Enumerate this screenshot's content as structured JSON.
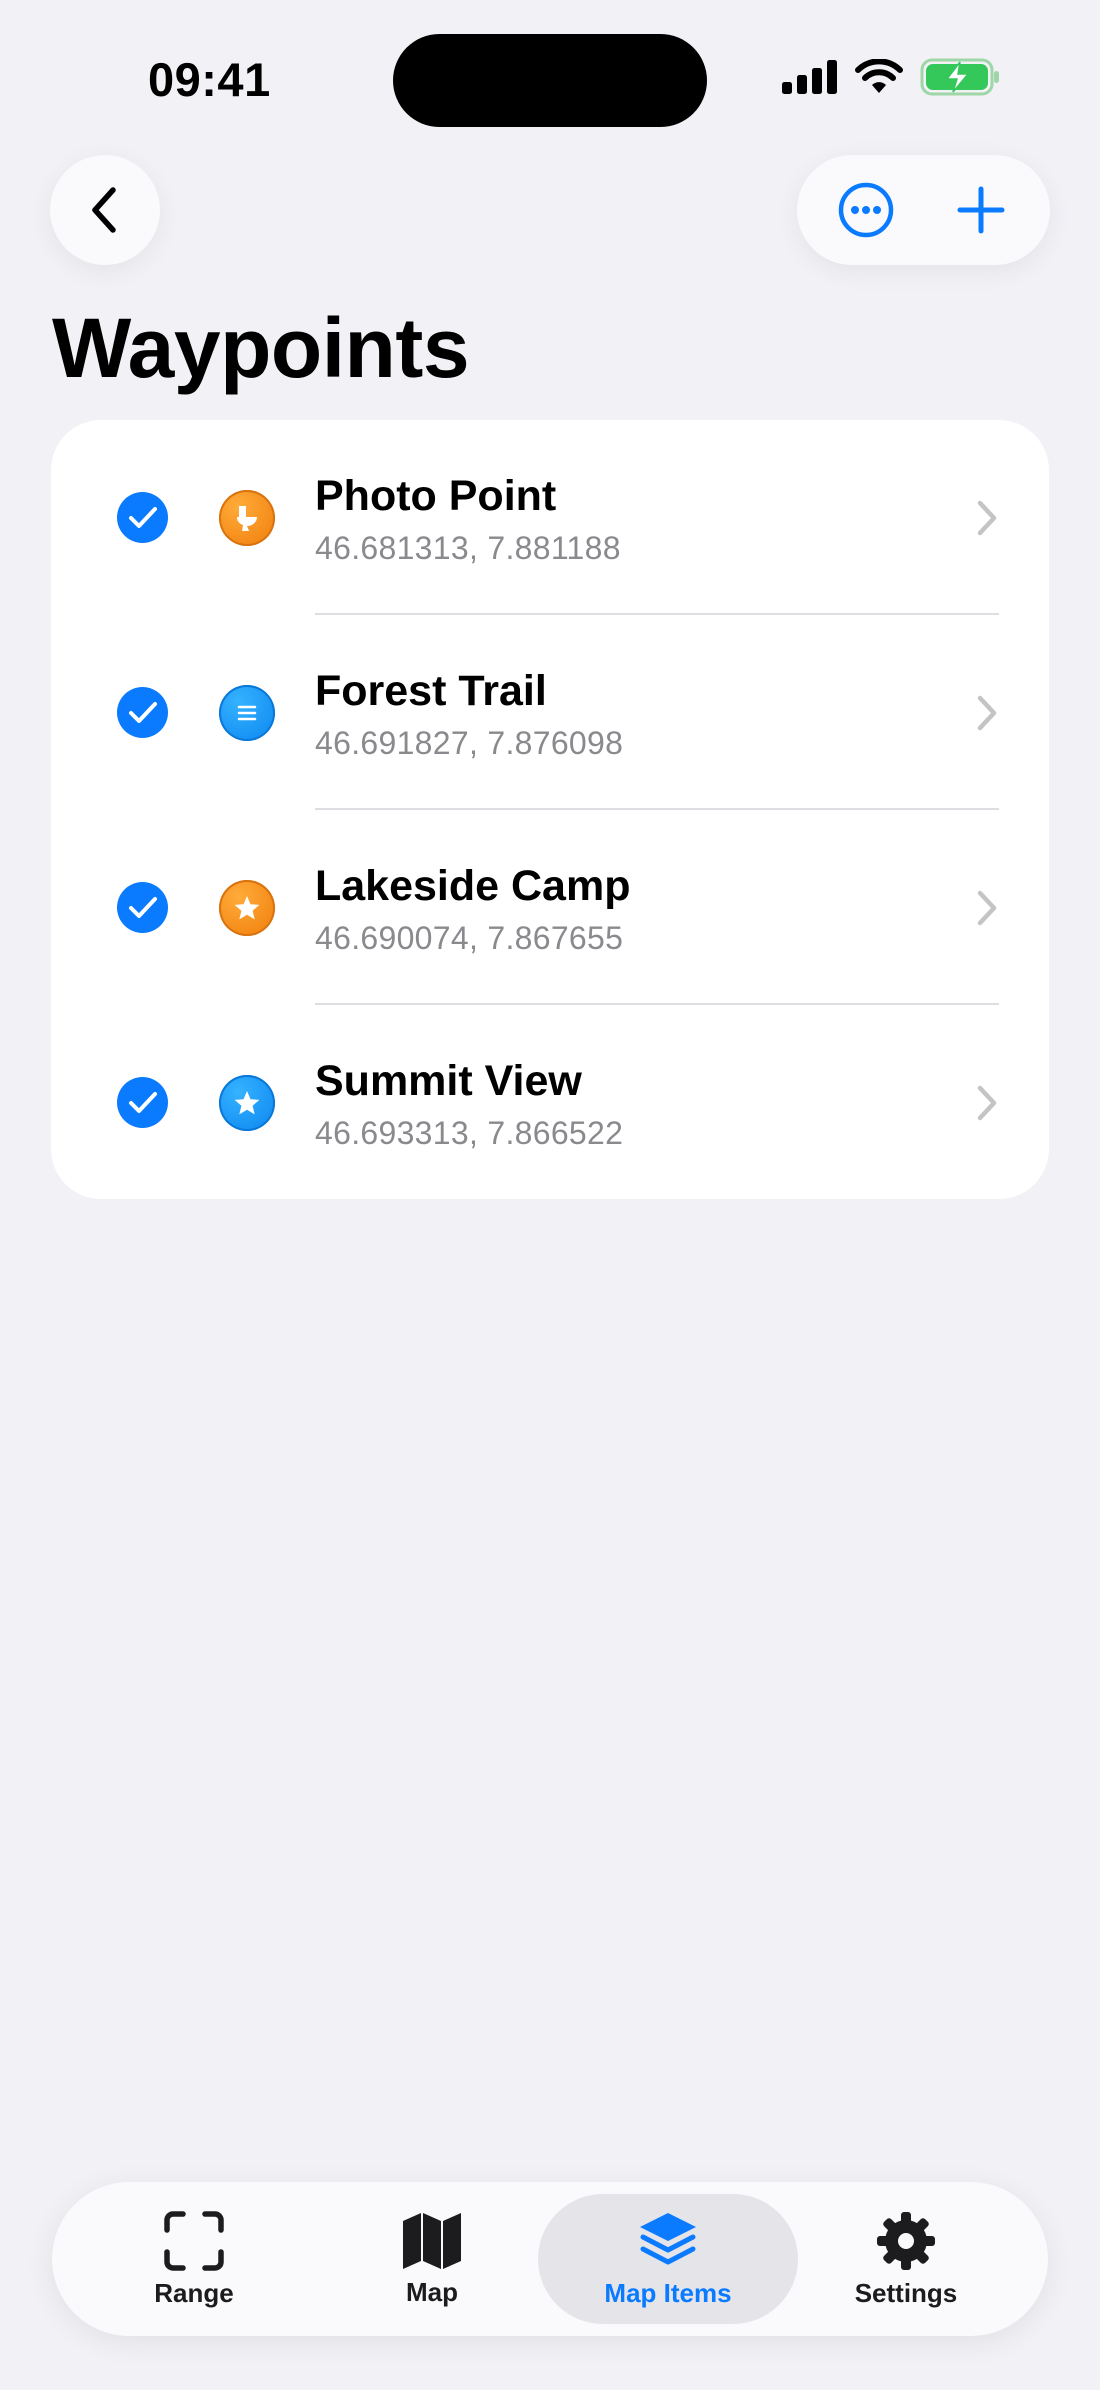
{
  "status_bar": {
    "time": "09:41"
  },
  "nav": {
    "title": "Waypoints"
  },
  "waypoints": [
    {
      "name": "Photo Point",
      "coords": "46.681313, 7.881188",
      "icon": "toilet-icon",
      "color": "#f58a17",
      "checked": true
    },
    {
      "name": "Forest Trail",
      "coords": "46.691827, 7.876098",
      "icon": "list-icon",
      "color": "#1a95f5",
      "checked": true
    },
    {
      "name": "Lakeside Camp",
      "coords": "46.690074, 7.867655",
      "icon": "star-icon",
      "color": "#f58a17",
      "checked": true
    },
    {
      "name": "Summit View",
      "coords": "46.693313, 7.866522",
      "icon": "star-icon",
      "color": "#1a95f5",
      "checked": true
    }
  ],
  "tabbar": {
    "tabs": [
      {
        "label": "Range",
        "icon": "range-icon"
      },
      {
        "label": "Map",
        "icon": "map-icon"
      },
      {
        "label": "Map Items",
        "icon": "layers-icon",
        "active": true
      },
      {
        "label": "Settings",
        "icon": "gear-icon"
      }
    ]
  },
  "colors": {
    "accent": "#0a7aff",
    "background": "#f1f1f6"
  }
}
